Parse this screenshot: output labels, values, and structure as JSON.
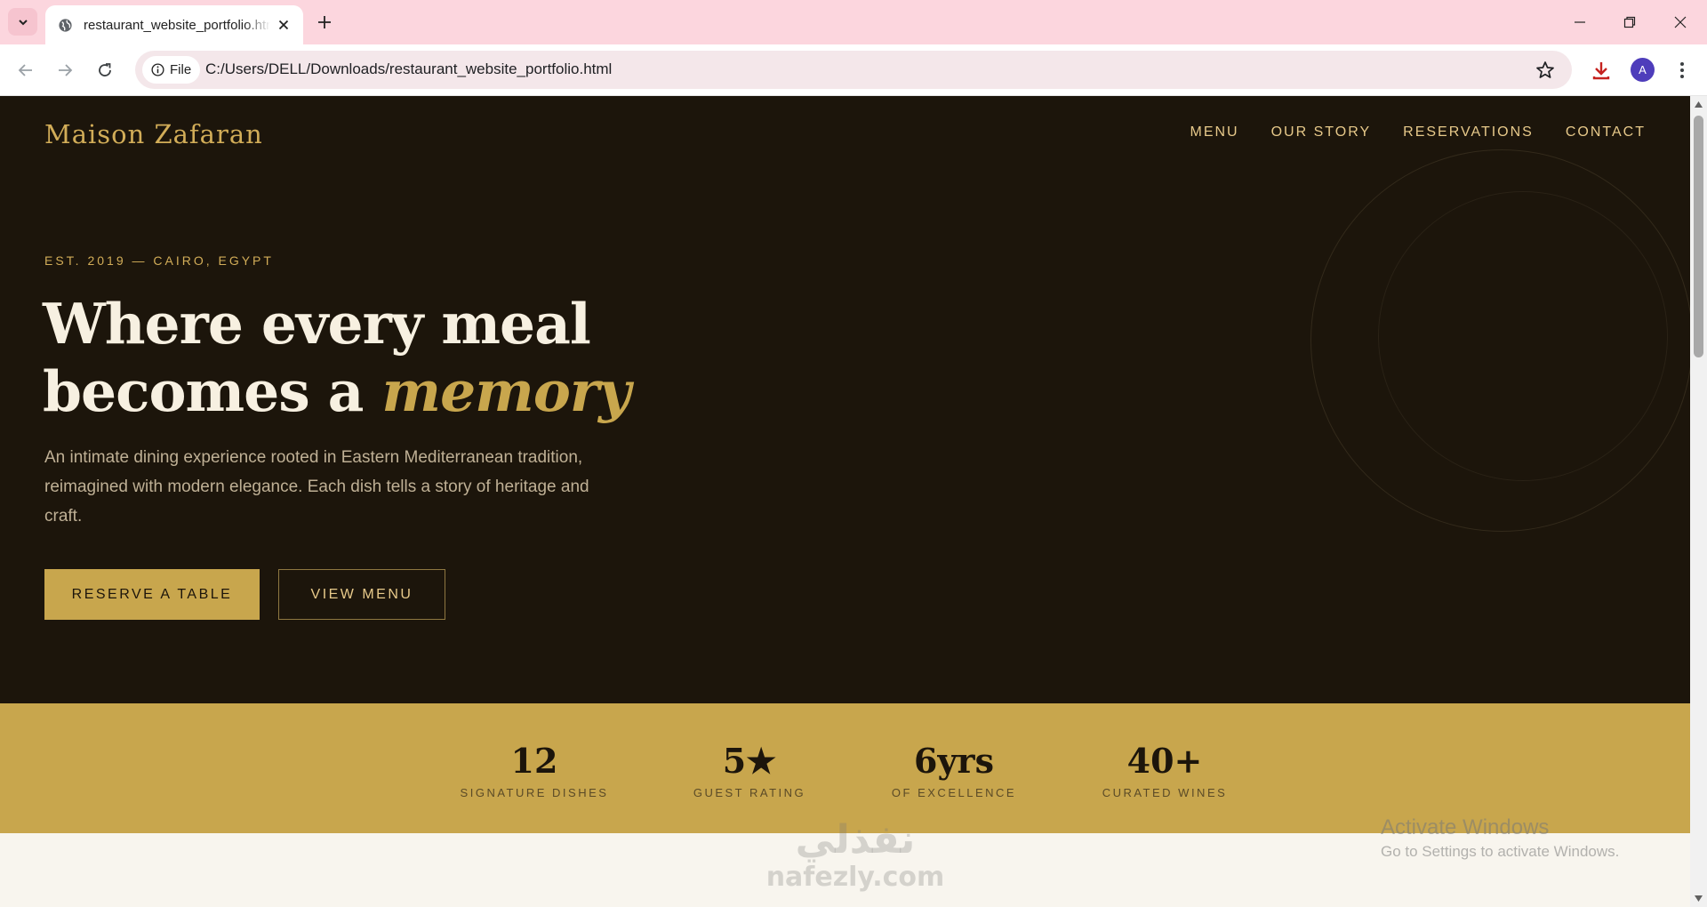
{
  "browser": {
    "tab_title": "restaurant_website_portfolio.html",
    "address_chip": "File",
    "url": "C:/Users/DELL/Downloads/restaurant_website_portfolio.html",
    "profile_initial": "A"
  },
  "site": {
    "brand": "Maison Zafaran",
    "nav": [
      "MENU",
      "OUR STORY",
      "RESERVATIONS",
      "CONTACT"
    ]
  },
  "hero": {
    "eyebrow": "EST. 2019 — CAIRO, EGYPT",
    "headline_line1": "Where every meal",
    "headline_line2_lead": "becomes a ",
    "headline_line2_accent": "memory",
    "lede": "An intimate dining experience rooted in Eastern Mediterranean tradition, reimagined with modern elegance. Each dish tells a story of heritage and craft.",
    "primary_cta": "RESERVE A TABLE",
    "secondary_cta": "VIEW MENU"
  },
  "stats": [
    {
      "value": "12",
      "label": "SIGNATURE DISHES"
    },
    {
      "value": "5★",
      "label": "GUEST RATING"
    },
    {
      "value": "6yrs",
      "label": "OF EXCELLENCE"
    },
    {
      "value": "40+",
      "label": "CURATED WINES"
    }
  ],
  "overlays": {
    "watermark_arabic": "نفذلي",
    "watermark_domain": "nafezly.com",
    "activate_title": "Activate Windows",
    "activate_sub": "Go to Settings to activate Windows."
  },
  "colors": {
    "hero_bg": "#1c150b",
    "gold": "#c8a64d",
    "cream": "#f7f0e1",
    "tabbar": "#fcd6de"
  }
}
